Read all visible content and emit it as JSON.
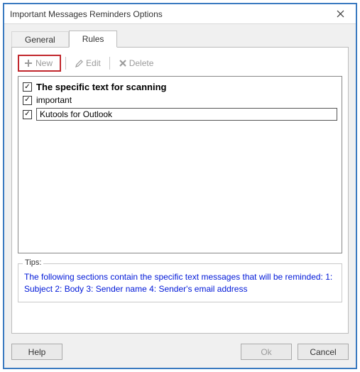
{
  "window": {
    "title": "Important Messages Reminders Options"
  },
  "tabs": {
    "general": "General",
    "rules": "Rules"
  },
  "toolbar": {
    "new_label": "New",
    "edit_label": "Edit",
    "delete_label": "Delete"
  },
  "rules": {
    "header": "The specific text for scanning",
    "item1": "important",
    "item2_value": "Kutools for Outlook"
  },
  "tips": {
    "legend": "Tips:",
    "text": "The following sections contain the specific text messages that will be reminded: 1: Subject 2: Body 3: Sender name 4: Sender's email address"
  },
  "buttons": {
    "help": "Help",
    "ok": "Ok",
    "cancel": "Cancel"
  }
}
